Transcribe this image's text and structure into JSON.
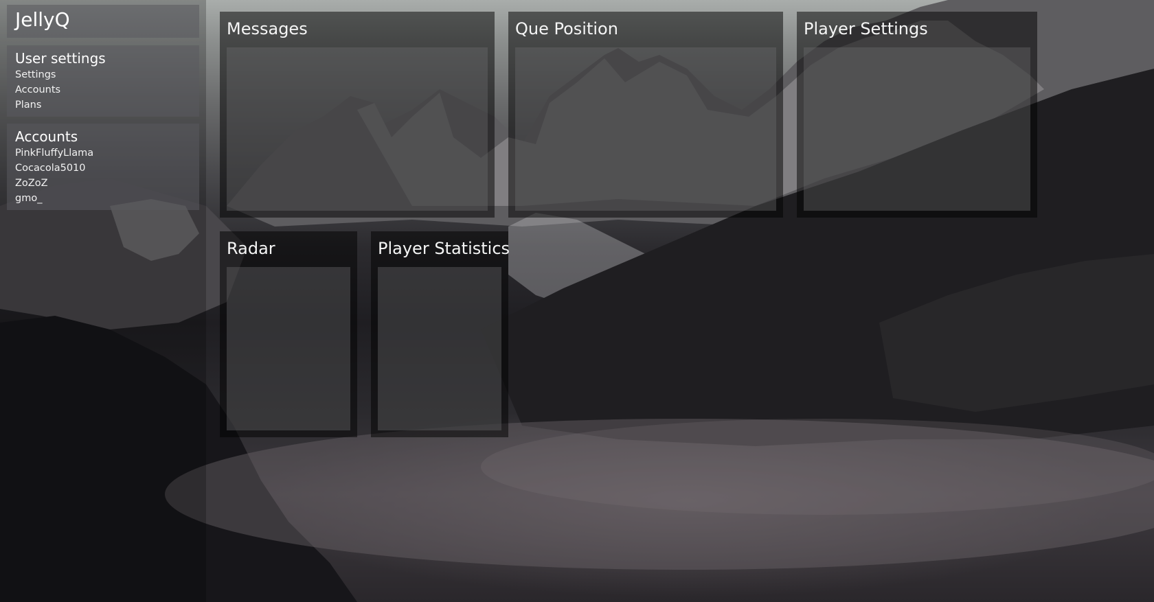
{
  "app": {
    "brand": "JellyQ"
  },
  "sidebar": {
    "user_settings": {
      "title": "User settings",
      "items": [
        "Settings",
        "Accounts",
        "Plans"
      ]
    },
    "accounts": {
      "title": "Accounts",
      "items": [
        "PinkFluffyLlama",
        "Cocacola5010",
        "ZoZoZ",
        "gmo_"
      ]
    }
  },
  "panels": {
    "messages": "Messages",
    "que_position": "Que Position",
    "player_settings": "Player Settings",
    "radar": "Radar",
    "player_statistics": "Player Statistics"
  },
  "colors": {
    "panel_overlay": "#000000",
    "text": "#ffffff"
  }
}
